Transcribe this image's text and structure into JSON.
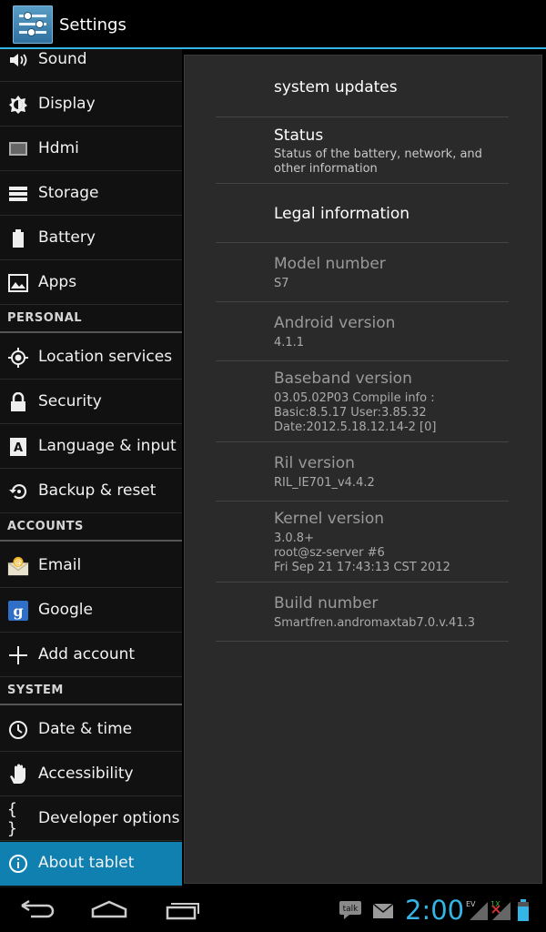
{
  "app": {
    "title": "Settings",
    "icon": "settings-icon"
  },
  "sidebar": {
    "items": [
      {
        "label": "Sound",
        "icon": "speaker-icon"
      },
      {
        "label": "Display",
        "icon": "brightness-icon"
      },
      {
        "label": "Hdmi",
        "icon": "monitor-icon"
      },
      {
        "label": "Storage",
        "icon": "storage-icon"
      },
      {
        "label": "Battery",
        "icon": "battery-icon"
      },
      {
        "label": "Apps",
        "icon": "apps-icon"
      }
    ],
    "personal_header": "PERSONAL",
    "personal": [
      {
        "label": "Location services",
        "icon": "location-icon"
      },
      {
        "label": "Security",
        "icon": "lock-icon"
      },
      {
        "label": "Language & input",
        "icon": "keyboard-icon"
      },
      {
        "label": "Backup & reset",
        "icon": "backup-icon"
      }
    ],
    "accounts_header": "ACCOUNTS",
    "accounts": [
      {
        "label": "Email",
        "icon": "email-icon"
      },
      {
        "label": "Google",
        "icon": "google-icon"
      },
      {
        "label": "Add account",
        "icon": "plus-icon"
      }
    ],
    "system_header": "SYSTEM",
    "system": [
      {
        "label": "Date & time",
        "icon": "clock-icon"
      },
      {
        "label": "Accessibility",
        "icon": "hand-icon"
      },
      {
        "label": "Developer options",
        "icon": "braces-icon"
      },
      {
        "label": "About tablet",
        "icon": "info-icon",
        "selected": true
      }
    ]
  },
  "about": {
    "system_updates": "system updates",
    "status_title": "Status",
    "status_sub": "Status of the battery, network, and\nother information",
    "legal": "Legal information",
    "model_title": "Model number",
    "model_value": "S7",
    "android_title": "Android version",
    "android_value": "4.1.1",
    "baseband_title": "Baseband version",
    "baseband_value": "03.05.02P03  Compile info :\nBasic:8.5.17 User:3.85.32\nDate:2012.5.18.12.14-2 [0]",
    "ril_title": "Ril version",
    "ril_value": "RIL_IE701_v4.4.2",
    "kernel_title": "Kernel version",
    "kernel_value": "3.0.8+\nroot@sz-server #6\nFri Sep 21 17:43:13 CST 2012",
    "build_title": "Build number",
    "build_value": "Smartfren.andromaxtab7.0.v.41.3"
  },
  "statusbar": {
    "time": "2:00",
    "talk_label": "talk",
    "network_label": "EV",
    "signal_label": "1X"
  },
  "colors": {
    "accent": "#33b5e5",
    "selected": "#0f80b0"
  }
}
